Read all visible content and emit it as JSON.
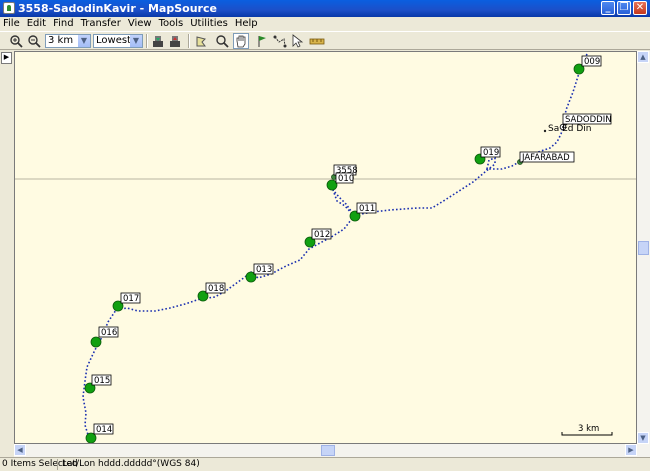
{
  "window": {
    "title": "3558-SadodinKavir - MapSource"
  },
  "menu": [
    "File",
    "Edit",
    "Find",
    "Transfer",
    "View",
    "Tools",
    "Utilities",
    "Help"
  ],
  "toolbar": {
    "zoom_value": "3 km",
    "detail_value": "Lowest"
  },
  "map": {
    "waypoints": [
      "009",
      "SADODDIN",
      "019",
      "JAFARABAD",
      "3558",
      "010",
      "011",
      "012",
      "013",
      "018",
      "017",
      "016",
      "015",
      "014"
    ],
    "place_label": "Sa Ed Din",
    "scale_label": "3 km"
  },
  "status": {
    "items_selected": "0 Items Selected",
    "coordinate_format": "Lat/Lon hddd.ddddd°(WGS 84)"
  },
  "colors": {
    "map_bg": "#fffbe2",
    "waypoint_green": "#11a011",
    "track_blue": "#1a2fb0",
    "title_blue": "#0a5fe0"
  }
}
